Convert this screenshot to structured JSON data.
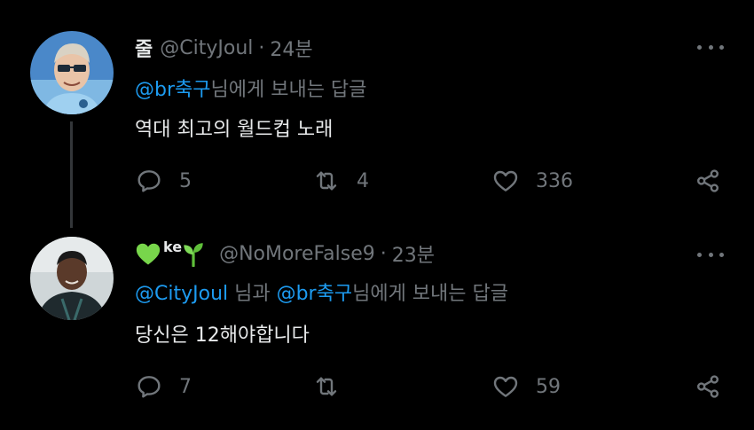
{
  "tweets": [
    {
      "name": "줄",
      "handle": "@CityJoul",
      "dot": "·",
      "time": "24분",
      "reply_prefix_mention": "@br축구",
      "reply_suffix": "님에게 보내는 답글",
      "text": "역대 최고의 월드컵 노래",
      "replies": "5",
      "retweets": "4",
      "likes": "336"
    },
    {
      "name_badge": "ke",
      "handle": "@NoMoreFalse9",
      "dot": "·",
      "time": "23분",
      "reply_mention_1": "@CityJoul",
      "reply_mid": " 님과 ",
      "reply_mention_2": "@br축구",
      "reply_suffix": "님에게 보내는 답글",
      "text": "당신은 12해야합니다",
      "replies": "7",
      "likes": "59"
    }
  ],
  "colors": {
    "background": "#000000",
    "text": "#e7e9ea",
    "muted": "#71767b",
    "link": "#1d9bf0",
    "thread_line": "#333639",
    "heart_green": "#78d64b"
  },
  "icons": [
    "reply-icon",
    "retweet-icon",
    "like-icon",
    "share-icon",
    "more-icon",
    "green-heart-icon",
    "seedling-icon"
  ]
}
